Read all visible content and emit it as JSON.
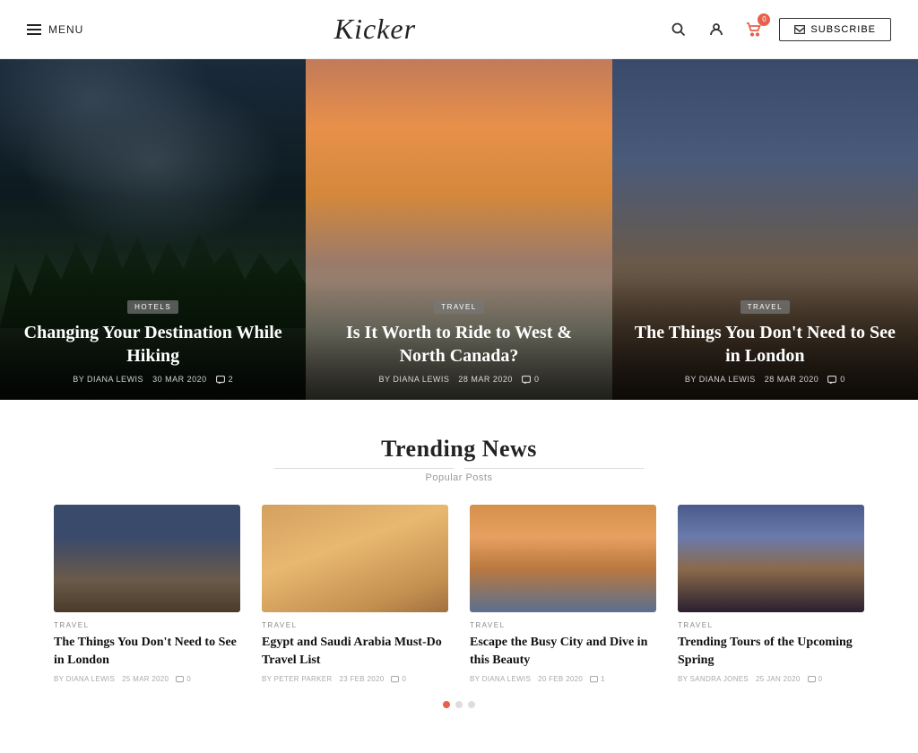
{
  "header": {
    "menu_label": "MENU",
    "logo": "Kicker",
    "cart_count": "0",
    "subscribe_label": "SUBSCRIBE"
  },
  "hero": {
    "cards": [
      {
        "category": "HOTELS",
        "title": "Changing Your Destination While Hiking",
        "author": "BY DIANA LEWIS",
        "date": "30 MAR 2020",
        "comments": "2"
      },
      {
        "category": "TRAVEL",
        "title": "Is It Worth to Ride to West & North Canada?",
        "author": "BY DIANA LEWIS",
        "date": "28 MAR 2020",
        "comments": "0"
      },
      {
        "category": "TRAVEL",
        "title": "The Things You Don't Need to See in London",
        "author": "BY DIANA LEWIS",
        "date": "28 MAR 2020",
        "comments": "0"
      }
    ]
  },
  "trending": {
    "title": "Trending News",
    "subtitle": "Popular Posts",
    "articles": [
      {
        "category": "TRAVEL",
        "title": "The Things You Don't Need to See in London",
        "author": "BY DIANA LEWIS",
        "date": "25 MAR 2020",
        "comments": "0"
      },
      {
        "category": "TRAVEL",
        "title": "Egypt and Saudi Arabia Must-Do Travel List",
        "author": "BY PETER PARKER",
        "date": "23 FEB 2020",
        "comments": "0"
      },
      {
        "category": "TRAVEL",
        "title": "Escape the Busy City and Dive in this Beauty",
        "author": "BY DIANA LEWIS",
        "date": "20 FEB 2020",
        "comments": "1"
      },
      {
        "category": "TRAVEL",
        "title": "Trending Tours of the Upcoming Spring",
        "author": "BY SANDRA JONES",
        "date": "25 JAN 2020",
        "comments": "0"
      }
    ]
  },
  "pagination": {
    "dots": [
      true,
      false,
      false
    ]
  }
}
